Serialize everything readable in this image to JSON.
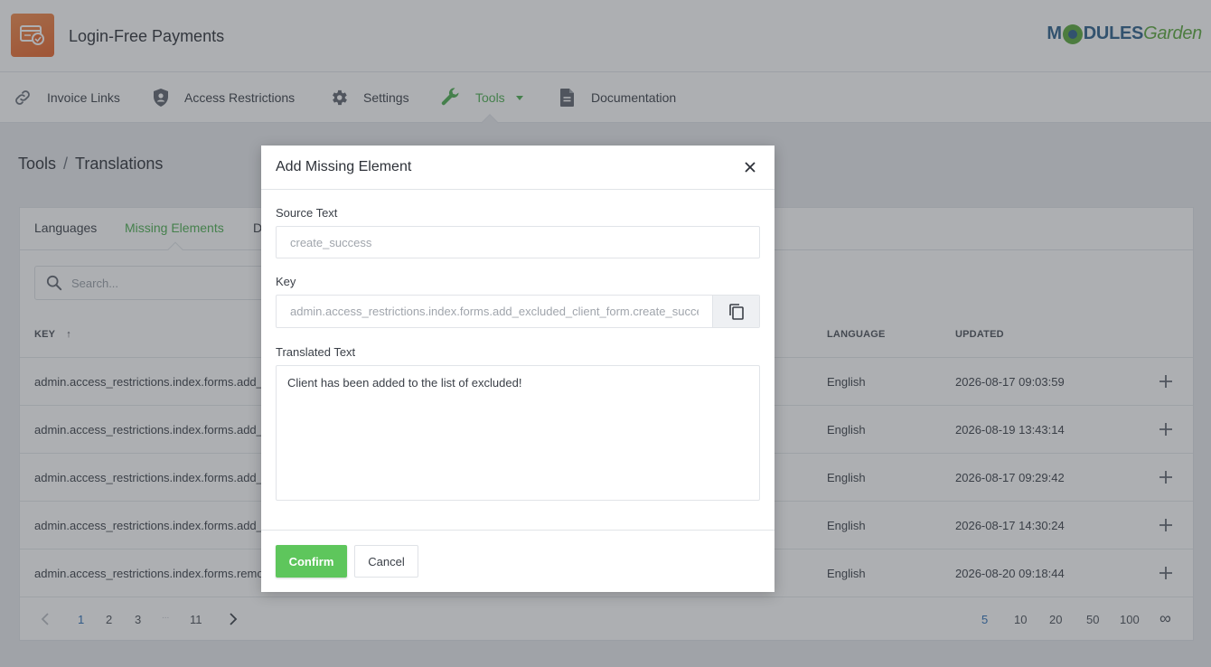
{
  "app": {
    "title": "Login-Free Payments",
    "brand_left": "M",
    "brand_mid": "DULES",
    "brand_right": "Garden"
  },
  "nav": {
    "items": [
      {
        "label": "Invoice Links",
        "icon": "link-icon"
      },
      {
        "label": "Access Restrictions",
        "icon": "shield-icon"
      },
      {
        "label": "Settings",
        "icon": "gear-icon"
      },
      {
        "label": "Tools",
        "icon": "wrench-icon",
        "active": true
      },
      {
        "label": "Documentation",
        "icon": "document-icon"
      }
    ]
  },
  "breadcrumb": {
    "part1": "Tools",
    "separator": "/",
    "part2": "Translations"
  },
  "tabs": [
    {
      "label": "Languages"
    },
    {
      "label": "Missing Elements",
      "active": true
    },
    {
      "label": "D"
    }
  ],
  "search": {
    "placeholder": "Search..."
  },
  "table": {
    "headers": {
      "key": "KEY",
      "sort_arrow": "↑",
      "language": "LANGUAGE",
      "updated": "UPDATED"
    },
    "rows": [
      {
        "key": "admin.access_restrictions.index.forms.add_",
        "language": "English",
        "updated": "2026-08-17 09:03:59"
      },
      {
        "key": "admin.access_restrictions.index.forms.add_",
        "language": "English",
        "updated": "2026-08-19 13:43:14"
      },
      {
        "key": "admin.access_restrictions.index.forms.add_",
        "language": "English",
        "updated": "2026-08-17 09:29:42"
      },
      {
        "key": "admin.access_restrictions.index.forms.add_",
        "language": "English",
        "updated": "2026-08-17 14:30:24"
      },
      {
        "key": "admin.access_restrictions.index.forms.remo",
        "language": "English",
        "updated": "2026-08-20 09:18:44"
      }
    ]
  },
  "pagination": {
    "pages": [
      "1",
      "2",
      "3",
      "...",
      "11"
    ],
    "per_page": [
      "5",
      "10",
      "20",
      "50",
      "100",
      "∞"
    ]
  },
  "modal": {
    "title": "Add Missing Element",
    "source_label": "Source Text",
    "source_value": "create_success",
    "key_label": "Key",
    "key_value": "admin.access_restrictions.index.forms.add_excluded_client_form.create_success",
    "translated_label": "Translated Text",
    "translated_value": "Client has been added to the list of excluded!",
    "confirm_label": "Confirm",
    "cancel_label": "Cancel"
  },
  "colors": {
    "accent": "#4caf50",
    "confirm": "#5ec65c",
    "link_active": "#2c6fb7",
    "logo_orange": "#e8642a"
  }
}
